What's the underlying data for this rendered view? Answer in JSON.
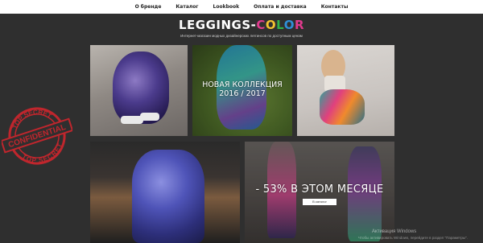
{
  "nav": {
    "items": [
      "О бренде",
      "Каталог",
      "Lookbook",
      "Оплата и доставка",
      "Контакты"
    ]
  },
  "brand": {
    "logo_part1": "LEGGINGS",
    "logo_sep": "-",
    "logo_letters": [
      "C",
      "O",
      "L",
      "O",
      "R"
    ],
    "tagline": "Интернет-магазин модных дизайнерских леггинсов по доступным ценам"
  },
  "tiles": {
    "new_collection": "НОВАЯ КОЛЛЕКЦИЯ 2016 / 2017",
    "discount_text": "- 53% В ЭТОМ МЕСЯЦЕ",
    "catalog_button": "В каталог"
  },
  "stamp": {
    "top": "TOP SECRET",
    "middle": "CONFIDENTIAL",
    "bottom": "TOP SECRET"
  },
  "os_watermark": {
    "line1": "Активация Windows",
    "line2": "Чтобы активировать Windows, перейдите в раздел \"Параметры\"."
  },
  "colors": {
    "stamp_red": "#c0262d",
    "background": "#2f2f2f",
    "nav_bg": "#ffffff"
  }
}
